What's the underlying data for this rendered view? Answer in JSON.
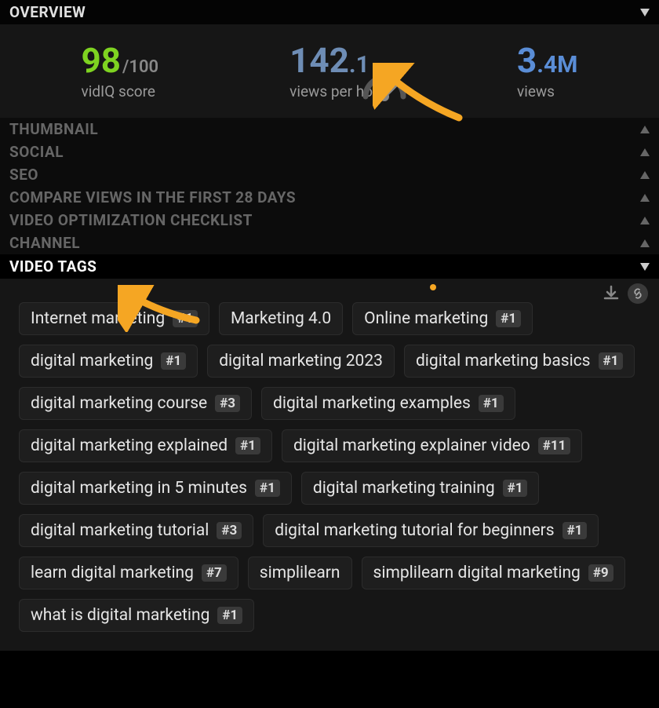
{
  "sections": {
    "overview": {
      "label": "OVERVIEW",
      "score": {
        "value": "98",
        "denom": "/100",
        "label": "vidIQ score"
      },
      "vph": {
        "value": "142",
        "decimal": ".1",
        "label": "views per hour"
      },
      "views": {
        "value": "3",
        "decimal": ".4",
        "suffix": "M",
        "label": "views"
      }
    },
    "thumbnail": {
      "label": "THUMBNAIL"
    },
    "social": {
      "label": "SOCIAL"
    },
    "seo": {
      "label": "SEO"
    },
    "compare": {
      "label": "COMPARE VIEWS IN THE FIRST 28 DAYS"
    },
    "checklist": {
      "label": "VIDEO OPTIMIZATION CHECKLIST"
    },
    "channel": {
      "label": "CHANNEL"
    },
    "tags": {
      "label": "VIDEO TAGS"
    }
  },
  "tags": [
    {
      "text": "Internet marketing",
      "rank": "#1"
    },
    {
      "text": "Marketing 4.0",
      "rank": null
    },
    {
      "text": "Online marketing",
      "rank": "#1"
    },
    {
      "text": "digital marketing",
      "rank": "#1"
    },
    {
      "text": "digital marketing 2023",
      "rank": null
    },
    {
      "text": "digital marketing basics",
      "rank": "#1"
    },
    {
      "text": "digital marketing course",
      "rank": "#3"
    },
    {
      "text": "digital marketing examples",
      "rank": "#1"
    },
    {
      "text": "digital marketing explained",
      "rank": "#1"
    },
    {
      "text": "digital marketing explainer video",
      "rank": "#11"
    },
    {
      "text": "digital marketing in 5 minutes",
      "rank": "#1"
    },
    {
      "text": "digital marketing training",
      "rank": "#1"
    },
    {
      "text": "digital marketing tutorial",
      "rank": "#3"
    },
    {
      "text": "digital marketing tutorial for beginners",
      "rank": "#1"
    },
    {
      "text": "learn digital marketing",
      "rank": "#7"
    },
    {
      "text": "simplilearn",
      "rank": null
    },
    {
      "text": "simplilearn digital marketing",
      "rank": "#9"
    },
    {
      "text": "what is digital marketing",
      "rank": "#1"
    }
  ]
}
